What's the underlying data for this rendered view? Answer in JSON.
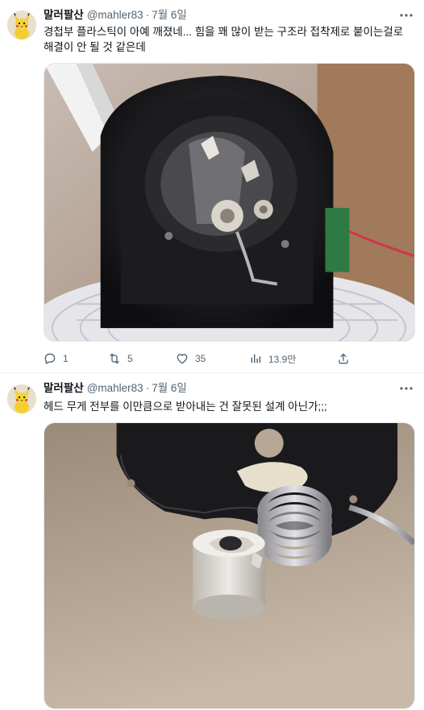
{
  "tweets": [
    {
      "name": "말러팔산",
      "handle": "@mahler83",
      "separator": "·",
      "date": "7월 6일",
      "text": "경첩부 플라스틱이 아예 깨졌네... 힘을 꽤 많이 받는 구조라 접착제로 붙이는걸로 해결이 안 될 것 같은데",
      "stats": {
        "replies": "1",
        "retweets": "5",
        "likes": "35",
        "views": "13.9만"
      }
    },
    {
      "name": "말러팔산",
      "handle": "@mahler83",
      "separator": "·",
      "date": "7월 6일",
      "text": "헤드 무게 전부를 이만큼으로 받아내는 건 잘못된 설계 아닌가;;;"
    }
  ],
  "icons": {
    "more": "more-dots-icon",
    "reply": "reply-icon",
    "retweet": "retweet-icon",
    "like": "heart-icon",
    "views": "views-chart-icon",
    "share": "share-icon"
  },
  "colors": {
    "text_primary": "#0f1419",
    "text_secondary": "#536471",
    "divider": "#eff3f4"
  }
}
